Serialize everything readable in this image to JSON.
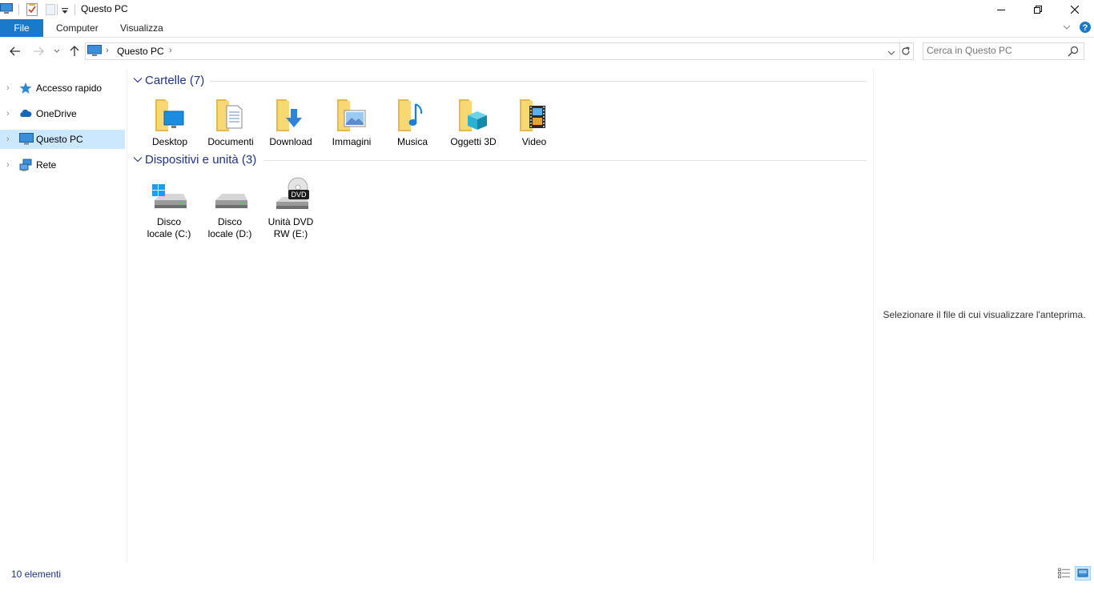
{
  "window": {
    "title": "Questo PC"
  },
  "ribbon": {
    "tabs": [
      "File",
      "Computer",
      "Visualizza"
    ]
  },
  "address": {
    "breadcrumb": "Questo PC"
  },
  "search": {
    "placeholder": "Cerca in Questo PC"
  },
  "nav": {
    "items": [
      {
        "label": "Accesso rapido",
        "icon": "star-icon"
      },
      {
        "label": "OneDrive",
        "icon": "cloud-icon"
      },
      {
        "label": "Questo PC",
        "icon": "computer-icon",
        "selected": true
      },
      {
        "label": "Rete",
        "icon": "network-icon"
      }
    ]
  },
  "groups": {
    "folders": {
      "title": "Cartelle (7)",
      "items": [
        "Desktop",
        "Documenti",
        "Download",
        "Immagini",
        "Musica",
        "Oggetti 3D",
        "Video"
      ]
    },
    "devices": {
      "title": "Dispositivi e unità (3)",
      "items": [
        {
          "line1": "Disco",
          "line2": "locale (C:)"
        },
        {
          "line1": "Disco",
          "line2": "locale (D:)"
        },
        {
          "line1": "Unità DVD",
          "line2": "RW (E:)",
          "badge": "DVD"
        }
      ]
    }
  },
  "preview": {
    "message": "Selezionare il file di cui visualizzare l'anteprima."
  },
  "status": {
    "count": "10 elementi"
  },
  "colors": {
    "accent": "#1979ca",
    "selection": "#cce8ff",
    "group_title": "#1e3287",
    "folder": "#f8d775"
  }
}
